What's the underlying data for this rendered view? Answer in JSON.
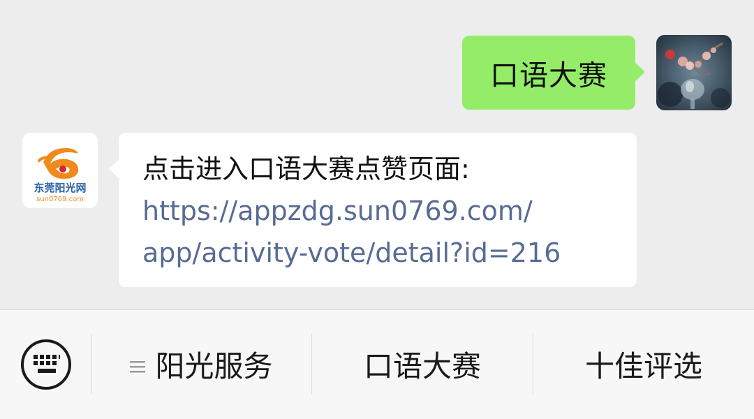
{
  "chat": {
    "outgoing": {
      "text": "口语大赛"
    },
    "incoming": {
      "title": "点击进入口语大赛点赞页面:",
      "link_line1": "https://appzdg.sun0769.com/",
      "link_line2": "app/activity-vote/detail?id=216"
    },
    "bot_avatar": {
      "logo_name": "东莞阳光网",
      "logo_domain": "sun0769.com"
    }
  },
  "menu": {
    "items": [
      {
        "label": "阳光服务",
        "has_submenu_icon": true
      },
      {
        "label": "口语大赛"
      },
      {
        "label": "十佳评选"
      }
    ]
  },
  "colors": {
    "outgoing_bubble": "#95ec69",
    "link": "#576b95",
    "logo_orange": "#f08a1c",
    "logo_red": "#d6272a"
  },
  "icons": {
    "keyboard": "keyboard-icon",
    "submenu": "hamburger-icon"
  }
}
